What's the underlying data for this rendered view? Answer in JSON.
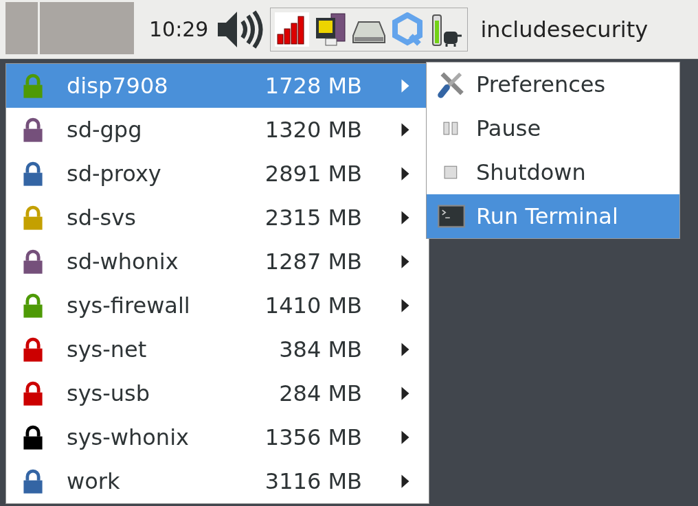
{
  "panel": {
    "clock": "10:29",
    "user": "includesecurity"
  },
  "qubes": [
    {
      "name": "disp7908",
      "memory": "1728 MB",
      "color": "#4e9a06",
      "selected": true
    },
    {
      "name": "sd-gpg",
      "memory": "1320 MB",
      "color": "#75507b",
      "selected": false
    },
    {
      "name": "sd-proxy",
      "memory": "2891 MB",
      "color": "#3465a4",
      "selected": false
    },
    {
      "name": "sd-svs",
      "memory": "2315 MB",
      "color": "#c4a000",
      "selected": false
    },
    {
      "name": "sd-whonix",
      "memory": "1287 MB",
      "color": "#75507b",
      "selected": false
    },
    {
      "name": "sys-firewall",
      "memory": "1410 MB",
      "color": "#4e9a06",
      "selected": false
    },
    {
      "name": "sys-net",
      "memory": "384 MB",
      "color": "#cc0000",
      "selected": false
    },
    {
      "name": "sys-usb",
      "memory": "284 MB",
      "color": "#cc0000",
      "selected": false
    },
    {
      "name": "sys-whonix",
      "memory": "1356 MB",
      "color": "#000000",
      "selected": false
    },
    {
      "name": "work",
      "memory": "3116 MB",
      "color": "#3465a4",
      "selected": false
    }
  ],
  "submenu": [
    {
      "label": "Preferences",
      "kind": "preferences",
      "selected": false
    },
    {
      "label": "Pause",
      "kind": "pause",
      "selected": false
    },
    {
      "label": "Shutdown",
      "kind": "shutdown",
      "selected": false
    },
    {
      "label": "Run Terminal",
      "kind": "terminal",
      "selected": true
    }
  ]
}
